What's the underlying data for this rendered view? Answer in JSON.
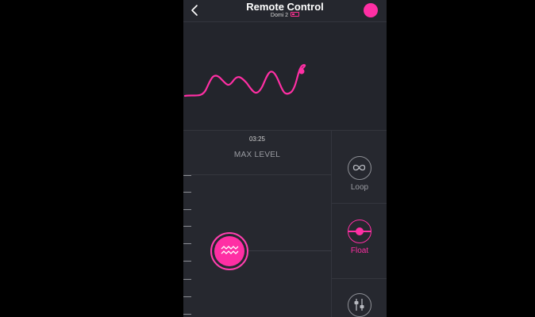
{
  "header": {
    "title": "Remote Control",
    "device": "Domi 2",
    "back_icon": "chevron-left-icon",
    "avatar_icon": "user-avatar-icon",
    "battery_icon": "battery-low-icon"
  },
  "control": {
    "timer": "03:25",
    "max_level_label": "MAX LEVEL",
    "knob_icon": "wave-icon"
  },
  "modes": [
    {
      "label": "Loop",
      "icon": "infinity-icon",
      "active": false
    },
    {
      "label": "Float",
      "icon": "float-icon",
      "active": true
    },
    {
      "label": "",
      "icon": "sliders-icon",
      "active": false
    }
  ],
  "colors": {
    "accent": "#ff2fa4",
    "background": "#262830",
    "inactive": "#9a9ca2"
  }
}
